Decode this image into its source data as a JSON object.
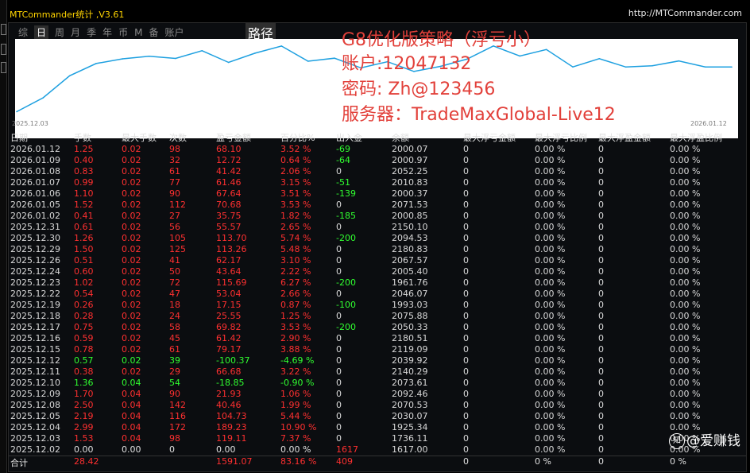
{
  "app": {
    "title": "MTCommander统计 ,V3.61",
    "url": "http://MTCommander.com"
  },
  "tabs": [
    "综",
    "日",
    "周",
    "月",
    "季",
    "年",
    "币",
    "M",
    "备",
    "账户"
  ],
  "active_tab": "日",
  "route_tab": "路径",
  "chart": {
    "x_start_label": "2025.12.03",
    "x_end_label": "2026.01.12",
    "line_color": "#1ea0e0",
    "background": "#ffffff"
  },
  "chart_data": {
    "type": "line",
    "x": [
      "2025.12.02",
      "2025.12.03",
      "2025.12.04",
      "2025.12.05",
      "2025.12.08",
      "2025.12.09",
      "2025.12.10",
      "2025.12.11",
      "2025.12.12",
      "2025.12.15",
      "2025.12.16",
      "2025.12.17",
      "2025.12.18",
      "2025.12.19",
      "2025.12.22",
      "2025.12.23",
      "2025.12.24",
      "2025.12.26",
      "2025.12.29",
      "2025.12.30",
      "2025.12.31",
      "2026.01.02",
      "2026.01.05",
      "2026.01.06",
      "2026.01.07",
      "2026.01.08",
      "2026.01.09",
      "2026.01.12"
    ],
    "values": [
      1617.0,
      1736.11,
      1925.34,
      2030.07,
      2070.53,
      2092.46,
      2073.61,
      2140.29,
      2039.92,
      2119.09,
      2180.51,
      2050.33,
      2075.88,
      1993.03,
      2046.07,
      1961.76,
      2005.4,
      2067.57,
      2180.83,
      2094.53,
      2150.1,
      2000.85,
      2071.53,
      2000.37,
      2010.83,
      2052.25,
      2000.97,
      2000.07
    ],
    "ylim": [
      1600,
      2200
    ],
    "grid": false
  },
  "overlay": {
    "title": "G8优化版策略（浮亏小）",
    "account": "账户:12047132",
    "password": "密码: Zh@123456",
    "server": "服务器：TradeMaxGlobal-Live12",
    "color": "#e2403a"
  },
  "table": {
    "headers": [
      "日期",
      "手数",
      "最大手数",
      "次数",
      "盈亏金额",
      "百分比%",
      "出入金",
      "余额",
      "最大浮亏金额",
      "最大浮亏比例",
      "最大浮盈金额",
      "最大浮盈比例"
    ],
    "rows": [
      {
        "date": "2026.01.12",
        "lots": "1.25",
        "max_lots": "0.02",
        "count": "98",
        "pnl": "68.10",
        "pct": "3.52 %",
        "flow": "-69",
        "balance": "2000.07",
        "dd_amt": "0",
        "dd_pct": "0.00 %",
        "fp_amt": "0",
        "fp_pct": "0.00 %",
        "sign": "pos"
      },
      {
        "date": "2026.01.09",
        "lots": "0.40",
        "max_lots": "0.02",
        "count": "32",
        "pnl": "12.72",
        "pct": "0.64 %",
        "flow": "-64",
        "balance": "2000.97",
        "dd_amt": "0",
        "dd_pct": "0.00 %",
        "fp_amt": "0",
        "fp_pct": "0.00 %",
        "sign": "pos"
      },
      {
        "date": "2026.01.08",
        "lots": "0.83",
        "max_lots": "0.02",
        "count": "61",
        "pnl": "41.42",
        "pct": "2.06 %",
        "flow": "0",
        "balance": "2052.25",
        "dd_amt": "0",
        "dd_pct": "0.00 %",
        "fp_amt": "0",
        "fp_pct": "0.00 %",
        "sign": "pos"
      },
      {
        "date": "2026.01.07",
        "lots": "0.99",
        "max_lots": "0.02",
        "count": "77",
        "pnl": "61.46",
        "pct": "3.15 %",
        "flow": "-51",
        "balance": "2010.83",
        "dd_amt": "0",
        "dd_pct": "0.00 %",
        "fp_amt": "0",
        "fp_pct": "0.00 %",
        "sign": "pos"
      },
      {
        "date": "2026.01.06",
        "lots": "1.10",
        "max_lots": "0.02",
        "count": "90",
        "pnl": "67.64",
        "pct": "3.51 %",
        "flow": "-139",
        "balance": "2000.37",
        "dd_amt": "0",
        "dd_pct": "0.00 %",
        "fp_amt": "0",
        "fp_pct": "0.00 %",
        "sign": "pos"
      },
      {
        "date": "2026.01.05",
        "lots": "1.52",
        "max_lots": "0.02",
        "count": "112",
        "pnl": "70.68",
        "pct": "3.53 %",
        "flow": "0",
        "balance": "2071.53",
        "dd_amt": "0",
        "dd_pct": "0.00 %",
        "fp_amt": "0",
        "fp_pct": "0.00 %",
        "sign": "pos"
      },
      {
        "date": "2026.01.02",
        "lots": "0.41",
        "max_lots": "0.02",
        "count": "27",
        "pnl": "35.75",
        "pct": "1.82 %",
        "flow": "-185",
        "balance": "2000.85",
        "dd_amt": "0",
        "dd_pct": "0.00 %",
        "fp_amt": "0",
        "fp_pct": "0.00 %",
        "sign": "pos"
      },
      {
        "date": "2025.12.31",
        "lots": "0.61",
        "max_lots": "0.02",
        "count": "56",
        "pnl": "55.57",
        "pct": "2.65 %",
        "flow": "0",
        "balance": "2150.10",
        "dd_amt": "0",
        "dd_pct": "0.00 %",
        "fp_amt": "0",
        "fp_pct": "0.00 %",
        "sign": "pos"
      },
      {
        "date": "2025.12.30",
        "lots": "1.26",
        "max_lots": "0.02",
        "count": "105",
        "pnl": "113.70",
        "pct": "5.74 %",
        "flow": "-200",
        "balance": "2094.53",
        "dd_amt": "0",
        "dd_pct": "0.00 %",
        "fp_amt": "0",
        "fp_pct": "0.00 %",
        "sign": "pos"
      },
      {
        "date": "2025.12.29",
        "lots": "1.50",
        "max_lots": "0.02",
        "count": "125",
        "pnl": "113.26",
        "pct": "5.48 %",
        "flow": "0",
        "balance": "2180.83",
        "dd_amt": "0",
        "dd_pct": "0.00 %",
        "fp_amt": "0",
        "fp_pct": "0.00 %",
        "sign": "pos"
      },
      {
        "date": "2025.12.26",
        "lots": "0.51",
        "max_lots": "0.02",
        "count": "41",
        "pnl": "62.17",
        "pct": "3.10 %",
        "flow": "0",
        "balance": "2067.57",
        "dd_amt": "0",
        "dd_pct": "0.00 %",
        "fp_amt": "0",
        "fp_pct": "0.00 %",
        "sign": "pos"
      },
      {
        "date": "2025.12.24",
        "lots": "0.60",
        "max_lots": "0.02",
        "count": "50",
        "pnl": "43.64",
        "pct": "2.22 %",
        "flow": "0",
        "balance": "2005.40",
        "dd_amt": "0",
        "dd_pct": "0.00 %",
        "fp_amt": "0",
        "fp_pct": "0.00 %",
        "sign": "pos"
      },
      {
        "date": "2025.12.23",
        "lots": "1.02",
        "max_lots": "0.02",
        "count": "72",
        "pnl": "115.69",
        "pct": "6.27 %",
        "flow": "-200",
        "balance": "1961.76",
        "dd_amt": "0",
        "dd_pct": "0.00 %",
        "fp_amt": "0",
        "fp_pct": "0.00 %",
        "sign": "pos"
      },
      {
        "date": "2025.12.22",
        "lots": "0.54",
        "max_lots": "0.02",
        "count": "47",
        "pnl": "53.04",
        "pct": "2.66 %",
        "flow": "0",
        "balance": "2046.07",
        "dd_amt": "0",
        "dd_pct": "0.00 %",
        "fp_amt": "0",
        "fp_pct": "0.00 %",
        "sign": "pos"
      },
      {
        "date": "2025.12.19",
        "lots": "0.26",
        "max_lots": "0.02",
        "count": "18",
        "pnl": "17.15",
        "pct": "0.87 %",
        "flow": "-100",
        "balance": "1993.03",
        "dd_amt": "0",
        "dd_pct": "0.00 %",
        "fp_amt": "0",
        "fp_pct": "0.00 %",
        "sign": "pos"
      },
      {
        "date": "2025.12.18",
        "lots": "0.28",
        "max_lots": "0.02",
        "count": "24",
        "pnl": "25.55",
        "pct": "1.25 %",
        "flow": "0",
        "balance": "2075.88",
        "dd_amt": "0",
        "dd_pct": "0.00 %",
        "fp_amt": "0",
        "fp_pct": "0.00 %",
        "sign": "pos"
      },
      {
        "date": "2025.12.17",
        "lots": "0.75",
        "max_lots": "0.02",
        "count": "58",
        "pnl": "69.82",
        "pct": "3.53 %",
        "flow": "-200",
        "balance": "2050.33",
        "dd_amt": "0",
        "dd_pct": "0.00 %",
        "fp_amt": "0",
        "fp_pct": "0.00 %",
        "sign": "pos"
      },
      {
        "date": "2025.12.16",
        "lots": "0.59",
        "max_lots": "0.02",
        "count": "45",
        "pnl": "61.42",
        "pct": "2.90 %",
        "flow": "0",
        "balance": "2180.51",
        "dd_amt": "0",
        "dd_pct": "0.00 %",
        "fp_amt": "0",
        "fp_pct": "0.00 %",
        "sign": "pos"
      },
      {
        "date": "2025.12.15",
        "lots": "0.78",
        "max_lots": "0.02",
        "count": "61",
        "pnl": "79.17",
        "pct": "3.88 %",
        "flow": "0",
        "balance": "2119.09",
        "dd_amt": "0",
        "dd_pct": "0.00 %",
        "fp_amt": "0",
        "fp_pct": "0.00 %",
        "sign": "pos"
      },
      {
        "date": "2025.12.12",
        "lots": "0.57",
        "max_lots": "0.02",
        "count": "39",
        "pnl": "-100.37",
        "pct": "-4.69 %",
        "flow": "0",
        "balance": "2039.92",
        "dd_amt": "0",
        "dd_pct": "0.00 %",
        "fp_amt": "0",
        "fp_pct": "0.00 %",
        "sign": "neg"
      },
      {
        "date": "2025.12.11",
        "lots": "0.38",
        "max_lots": "0.02",
        "count": "29",
        "pnl": "66.68",
        "pct": "3.22 %",
        "flow": "0",
        "balance": "2140.29",
        "dd_amt": "0",
        "dd_pct": "0.00 %",
        "fp_amt": "0",
        "fp_pct": "0.00 %",
        "sign": "pos"
      },
      {
        "date": "2025.12.10",
        "lots": "1.36",
        "max_lots": "0.04",
        "count": "54",
        "pnl": "-18.85",
        "pct": "-0.90 %",
        "flow": "0",
        "balance": "2073.61",
        "dd_amt": "0",
        "dd_pct": "0.00 %",
        "fp_amt": "0",
        "fp_pct": "0.00 %",
        "sign": "neg"
      },
      {
        "date": "2025.12.09",
        "lots": "1.70",
        "max_lots": "0.04",
        "count": "90",
        "pnl": "21.93",
        "pct": "1.06 %",
        "flow": "0",
        "balance": "2092.46",
        "dd_amt": "0",
        "dd_pct": "0.00 %",
        "fp_amt": "0",
        "fp_pct": "0.00 %",
        "sign": "pos"
      },
      {
        "date": "2025.12.08",
        "lots": "2.50",
        "max_lots": "0.04",
        "count": "142",
        "pnl": "40.46",
        "pct": "1.99 %",
        "flow": "0",
        "balance": "2070.53",
        "dd_amt": "0",
        "dd_pct": "0.00 %",
        "fp_amt": "0",
        "fp_pct": "0.00 %",
        "sign": "pos"
      },
      {
        "date": "2025.12.05",
        "lots": "2.19",
        "max_lots": "0.04",
        "count": "116",
        "pnl": "104.73",
        "pct": "5.44 %",
        "flow": "0",
        "balance": "2030.07",
        "dd_amt": "0",
        "dd_pct": "0.00 %",
        "fp_amt": "0",
        "fp_pct": "0.00 %",
        "sign": "pos"
      },
      {
        "date": "2025.12.04",
        "lots": "2.99",
        "max_lots": "0.04",
        "count": "172",
        "pnl": "189.23",
        "pct": "10.90 %",
        "flow": "0",
        "balance": "1925.34",
        "dd_amt": "0",
        "dd_pct": "0.00 %",
        "fp_amt": "0",
        "fp_pct": "0.00 %",
        "sign": "pos"
      },
      {
        "date": "2025.12.03",
        "lots": "1.53",
        "max_lots": "0.04",
        "count": "98",
        "pnl": "119.11",
        "pct": "7.37 %",
        "flow": "0",
        "balance": "1736.11",
        "dd_amt": "0",
        "dd_pct": "0.00 %",
        "fp_amt": "0",
        "fp_pct": "0.00 %",
        "sign": "pos"
      },
      {
        "date": "2025.12.02",
        "lots": "0.00",
        "max_lots": "0.00",
        "count": "0",
        "pnl": "0.00",
        "pct": "0.00 %",
        "flow": "1617",
        "balance": "1617.00",
        "dd_amt": "0",
        "dd_pct": "0.00 %",
        "fp_amt": "0",
        "fp_pct": "0.00 %",
        "sign": "zero"
      }
    ],
    "total": {
      "label": "合计",
      "lots": "28.42",
      "pnl": "1591.07",
      "pct": "83.16 %",
      "flow": "409",
      "dd_amt": "0",
      "dd_pct": "0 %",
      "fp_amt": "0",
      "fp_pct": "0 %"
    }
  },
  "watermark": {
    "icon": "知",
    "text": "@爱赚钱"
  }
}
